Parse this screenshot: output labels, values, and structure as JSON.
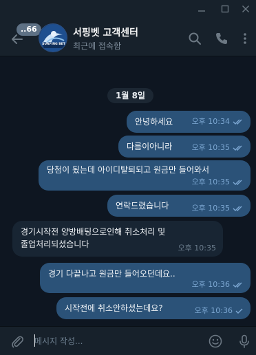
{
  "window": {
    "controls": [
      "minimize",
      "maximize",
      "close"
    ]
  },
  "header": {
    "unread_count": "66",
    "title": "서핑벳 고객센터",
    "status": "최근에 접속함",
    "avatar_text": "SURFING BET",
    "icons": [
      "search-icon",
      "phone-icon",
      "more-vertical-icon"
    ]
  },
  "date_separator": "1월 8일",
  "messages": [
    {
      "side": "out",
      "text": "안녕하세요",
      "time": "오후 10:34",
      "status": "read"
    },
    {
      "side": "out",
      "text": "다름이아니라",
      "time": "오후 10:35",
      "status": "read"
    },
    {
      "side": "out",
      "text": "당첨이 됬는데 아이디탈퇴되고 원금만 들어와서",
      "time": "오후 10:35",
      "status": "read"
    },
    {
      "side": "out",
      "text": "연락드렸습니다",
      "time": "오후 10:35",
      "status": "read"
    },
    {
      "side": "in",
      "line1": "경기시작전 양방배팅으로인해 취소처리 및",
      "line2": "졸업처리되셨습니다",
      "time": "오후 10:35"
    },
    {
      "side": "out",
      "text": "경기 다끝나고 원금만 들어오던데요..",
      "time": "오후 10:36",
      "status": "read"
    },
    {
      "side": "out",
      "text": "시작전에 취소안하셨는데요?",
      "time": "오후 10:36",
      "status": "sent"
    }
  ],
  "composer": {
    "placeholder": "메시지 작성..."
  },
  "colors": {
    "background": "#0e1621",
    "header": "#17212b",
    "outgoing_bubble": "#2b5278",
    "incoming_bubble": "#182533",
    "check": "#7da8d3"
  }
}
